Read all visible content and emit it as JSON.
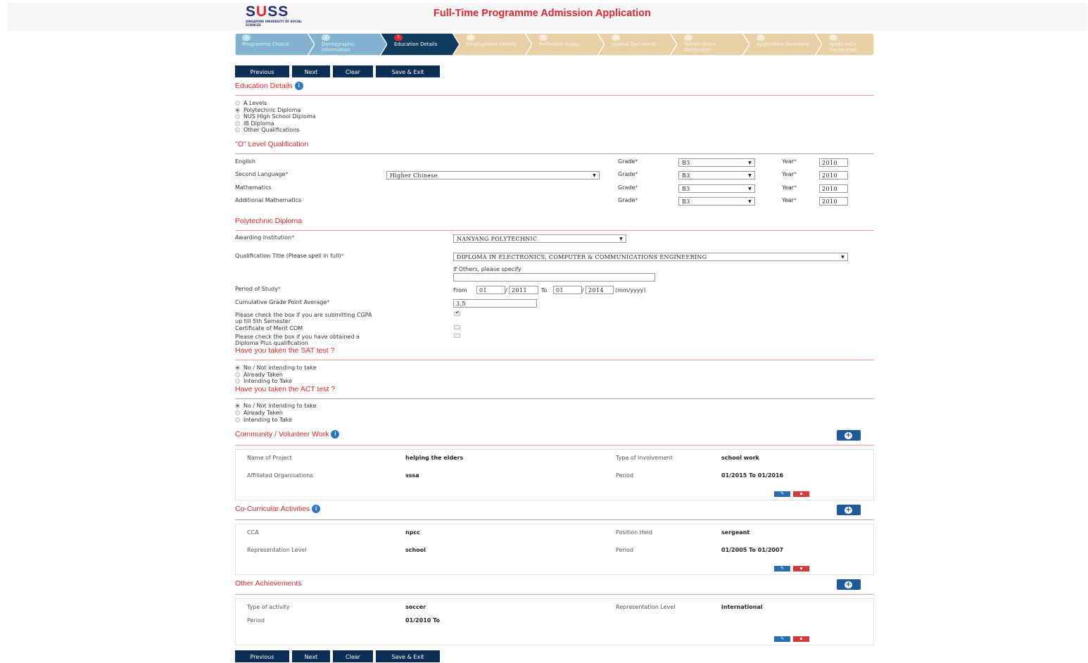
{
  "header": {
    "logo_main": "SUSS",
    "logo_sub": "SINGAPORE UNIVERSITY OF SOCIAL SCIENCES",
    "title": "Full-Time Programme Admission Application"
  },
  "steps": [
    {
      "num": "1",
      "label": "Programme Choice"
    },
    {
      "num": "2",
      "label": "Demographic Information"
    },
    {
      "num": "3",
      "label": "Education Details"
    },
    {
      "num": "4",
      "label": "Employment Details"
    },
    {
      "num": "5",
      "label": "Reflection Essay"
    },
    {
      "num": "6",
      "label": "Upload Document"
    },
    {
      "num": "7",
      "label": "Tuition Grant Declaration"
    },
    {
      "num": "8",
      "label": "Application Summary"
    },
    {
      "num": "9",
      "label": "Applicant's Declaration"
    }
  ],
  "buttons": {
    "previous": "Previous",
    "next": "Next",
    "clear": "Clear",
    "save_exit": "Save & Exit"
  },
  "education": {
    "title": "Education Details",
    "options": [
      "A Levels",
      "Polytechnic Diploma",
      "NUS High School Diploma",
      "IB Diploma",
      "Other Qualifications"
    ],
    "selected": "Polytechnic Diploma"
  },
  "o_level": {
    "title": "\"O\" Level Qualification",
    "grade_label": "Grade",
    "year_label": "Year",
    "rows": [
      {
        "subject": "English",
        "grade": "B3",
        "year": "2010"
      },
      {
        "subject": "Second Language",
        "language": "Higher Chinese",
        "grade": "B3",
        "year": "2010"
      },
      {
        "subject": "Mathematics",
        "grade": "B3",
        "year": "2010"
      },
      {
        "subject": "Additional Mathematics",
        "grade": "B3",
        "year": "2010"
      }
    ]
  },
  "poly": {
    "title": "Polytechnic Diploma",
    "institution_label": "Awarding Institution",
    "institution": "NANYANG POLYTECHNIC",
    "qual_label": "Qualification Title (Please spell in full)",
    "qual": "DIPLOMA IN ELECTRONICS, COMPUTER & COMMUNICATIONS ENGINEERING",
    "others_label": "If Others, please specify",
    "others_value": "",
    "period_label": "Period of Study",
    "from_label": "From",
    "from_month": "01",
    "from_year": "2011",
    "to_label": "To",
    "to_month": "01",
    "to_year": "2014",
    "date_hint": "(mm/yyyy)",
    "slash": "/",
    "cgpa_label": "Cumulative Grade Point Average",
    "cgpa": "3.5",
    "cgpa_check_label_1": "Please check the box if you are submitting CGPA",
    "cgpa_check_label_2": "up till 5th Semester",
    "merit_label": "Certificate of Merit COM",
    "diploma_plus_label_1": "Please check the box if you have obtained a",
    "diploma_plus_label_2": "Diploma Plus qualification"
  },
  "sat": {
    "title": "Have you taken the SAT test ?",
    "options": [
      "No / Not intending to take",
      "Already Taken",
      "Intending to Take"
    ]
  },
  "act": {
    "title": "Have you taken the ACT test ?",
    "options": [
      "No / Not intending to take",
      "Already Taken",
      "Intending to Take"
    ]
  },
  "community": {
    "title": "Community / Volunteer Work",
    "k1": "Name of Project",
    "v1": "helping the elders",
    "k2": "Type of involvement",
    "v2": "school work",
    "k3": "Affiliated Organisations",
    "v3": "sssa",
    "k4": "Period",
    "v4": "01/2015 To 01/2016"
  },
  "cca": {
    "title": "Co-Curricular Activities",
    "k1": "CCA",
    "v1": "npcc",
    "k2": "Position Held",
    "v2": "sergeant",
    "k3": "Representation Level",
    "v3": "school",
    "k4": "Period",
    "v4": "01/2005 To 01/2007"
  },
  "achievements": {
    "title": "Other Achievements",
    "k1": "Type of activity",
    "v1": "soccer",
    "k2": "Representation Level",
    "v2": "international",
    "k3": "Period",
    "v3": "01/2010 To"
  },
  "colors": {
    "navy": "#0b2e57",
    "accent_red": "#e8262f",
    "step_done": "#7fb3d0",
    "step_active": "#0f3b5f",
    "step_todo": "#e8cfa4"
  },
  "icons": {
    "info": "info-icon",
    "plus": "plus-circle-icon",
    "edit": "pencil-icon",
    "delete": "trash-icon"
  }
}
